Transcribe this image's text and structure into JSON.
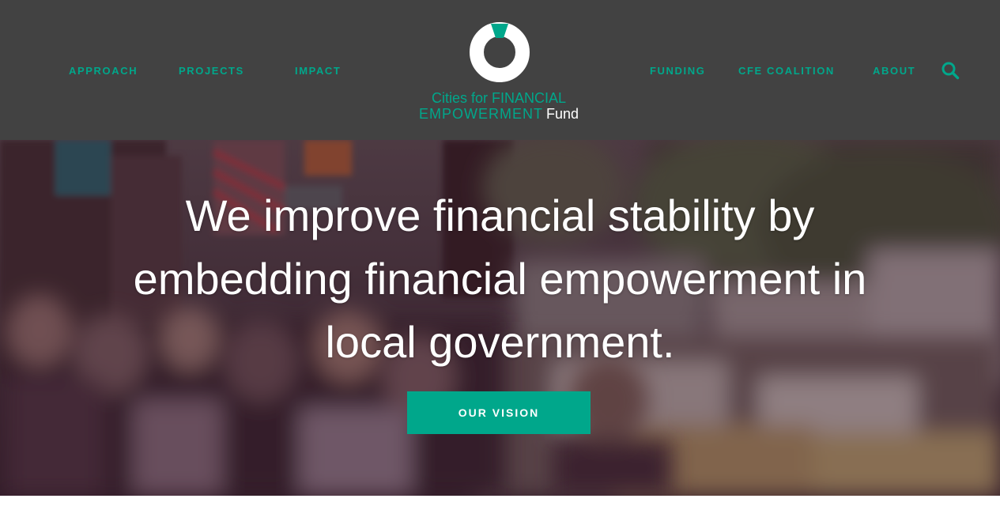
{
  "nav": {
    "left": [
      "APPROACH",
      "PROJECTS",
      "IMPACT"
    ],
    "right": [
      "FUNDING",
      "CFE COALITION",
      "ABOUT"
    ]
  },
  "logo": {
    "line1": "Cities for FINANCIAL",
    "line2_main": "EMPOWERMENT",
    "line2_fund": "Fund"
  },
  "icons": {
    "search": "search-icon",
    "logo_mark": "ring-logo-icon"
  },
  "hero": {
    "headline": "We improve financial stability by embedding financial empowerment in local government.",
    "cta_label": "OUR VISION"
  },
  "colors": {
    "header_bg": "#424242",
    "accent": "#00a78b",
    "hero_tint": "#3a2430",
    "text_on_dark": "#ffffff"
  }
}
